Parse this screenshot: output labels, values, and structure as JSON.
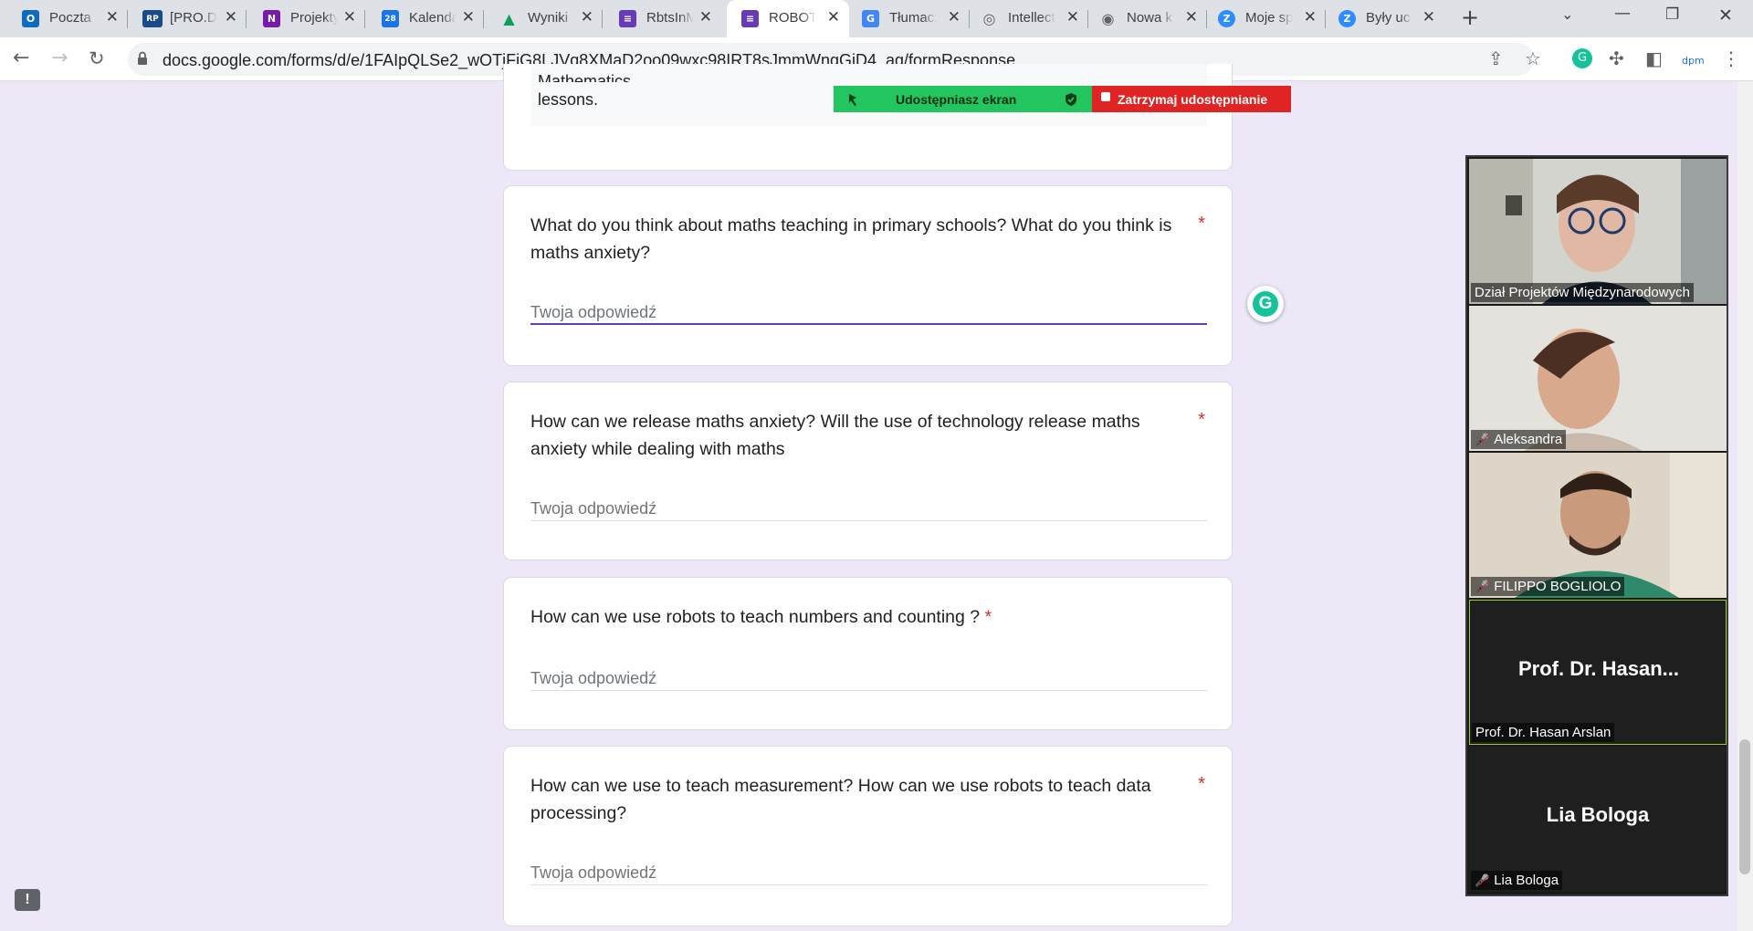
{
  "browser": {
    "tabs": [
      {
        "label": "Poczta",
        "favicon": "outlook-icon",
        "color": "#0f6cbd",
        "glyph": "O"
      },
      {
        "label": "[PRO.D",
        "favicon": "rp-icon",
        "color": "#1a4a8a",
        "glyph": "RP"
      },
      {
        "label": "Projekty",
        "favicon": "onenote-icon",
        "color": "#7719aa",
        "glyph": "N"
      },
      {
        "label": "Kalendarz",
        "favicon": "calendar-icon",
        "color": "#1a73e8",
        "glyph": "28"
      },
      {
        "label": "Wyniki",
        "favicon": "drive-icon",
        "color": "#0f9d58",
        "glyph": "▲"
      },
      {
        "label": "RbtsInM",
        "favicon": "forms-icon",
        "color": "#673ab7",
        "glyph": "≡"
      },
      {
        "label": "ROBOT",
        "favicon": "forms-icon",
        "color": "#673ab7",
        "glyph": "≡",
        "active": true
      },
      {
        "label": "Tłumacz",
        "favicon": "translate-icon",
        "color": "#4285f4",
        "glyph": "G"
      },
      {
        "label": "Intellect",
        "favicon": "intellect-icon",
        "color": "#5f6368",
        "glyph": "◎"
      },
      {
        "label": "Nowa k",
        "favicon": "chrome-icon",
        "color": "#5f6368",
        "glyph": "◉"
      },
      {
        "label": "Moje sp",
        "favicon": "zotero-icon",
        "color": "#2d8cff",
        "glyph": "Z"
      },
      {
        "label": "Były uc",
        "favicon": "zotero-icon",
        "color": "#2d8cff",
        "glyph": "Z"
      }
    ],
    "new_tab": "+",
    "url": "docs.google.com/forms/d/e/1FAIpQLSe2_wOTjFiG8LJVq8XMaD2oo09wxc98IRT8sJmmWngGjD4_ag/formResponse"
  },
  "form": {
    "prev_text_1": "Mathematics",
    "prev_text_2": "lessons.",
    "placeholder": "Twoja odpowiedź",
    "required_mark": "*",
    "questions": [
      {
        "text": "What do you think about maths teaching in primary schools? What do you think is maths anxiety?"
      },
      {
        "text": "How can we release maths anxiety? Will the use of technology release maths anxiety while dealing with maths"
      },
      {
        "text": "How can we use robots to teach numbers and counting ?"
      },
      {
        "text": "How can we use to teach measurement? How can we use robots to teach data processing?"
      }
    ]
  },
  "sharebar": {
    "sharing_label": "Udostępniasz ekran",
    "stop_label": "Zatrzymaj udostępnianie",
    "green": "#22c55e",
    "red": "#e02424"
  },
  "meeting": {
    "participants": [
      {
        "name": "Dział Projektów Międzynarodowych",
        "video": true,
        "muted": false
      },
      {
        "name": "Aleksandra",
        "video": true,
        "muted": true
      },
      {
        "name": "FILIPPO BOGLIOLO",
        "video": true,
        "muted": true
      },
      {
        "name": "Prof. Dr. Hasan Arslan",
        "display": "Prof. Dr. Hasan...",
        "video": false,
        "muted": false,
        "speaking": true
      },
      {
        "name": "Lia Bologa",
        "display": "Lia Bologa",
        "video": false,
        "muted": true
      }
    ]
  },
  "colors": {
    "page_bg": "#ede7f7",
    "accent": "#673ab7",
    "required": "#d93025"
  }
}
